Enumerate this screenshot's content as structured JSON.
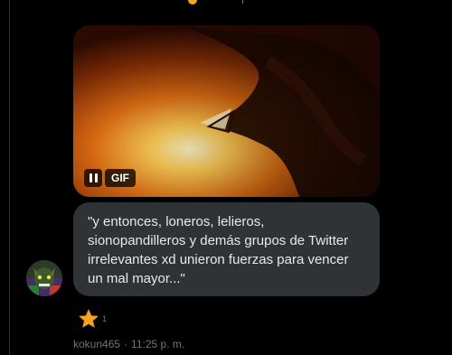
{
  "media": {
    "badge_label": "GIF",
    "pause_icon": "pause-icon"
  },
  "message": {
    "text": "\"y entonces, loneros, lelieros, sionopandilleros y demás grupos de Twitter irrelevantes xd unieron fuerzas para vencer un mal mayor...\""
  },
  "reaction": {
    "emoji": "star",
    "count": "1"
  },
  "meta": {
    "username": "kokun465",
    "separator": "·",
    "time": "11:25 p. m."
  },
  "colors": {
    "background": "#000000",
    "bubble": "#2f3336",
    "text": "#e7e9ea",
    "muted": "#71767b",
    "star": "#f5a623"
  }
}
